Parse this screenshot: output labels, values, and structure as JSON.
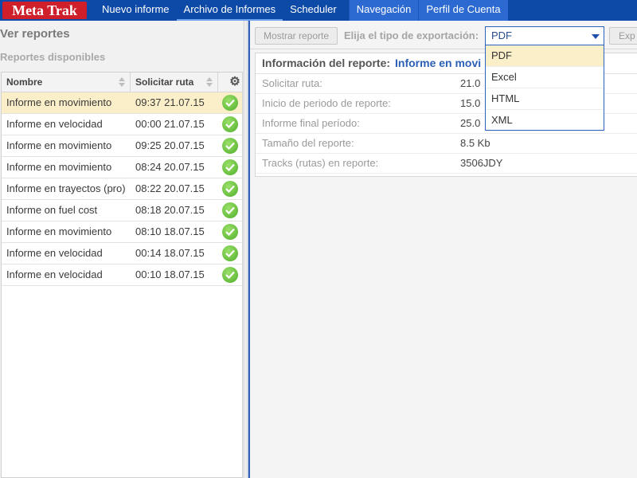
{
  "nav": {
    "logo": "Meta Trak",
    "items": [
      {
        "label": "Nuevo informe"
      },
      {
        "label": "Archivo de Informes"
      },
      {
        "label": "Scheduler"
      },
      {
        "label": "Navegación"
      },
      {
        "label": "Perfil de Cuenta"
      }
    ]
  },
  "left": {
    "title": "Ver reportes",
    "subtitle": "Reportes disponibles",
    "columns": {
      "name": "Nombre",
      "route": "Solicitar ruta",
      "settings_icon": "gear-icon"
    },
    "rows": [
      {
        "name": "Informe en movimiento",
        "time": "09:37 21.07.15",
        "selected": true
      },
      {
        "name": "Informe en velocidad",
        "time": "00:00 21.07.15"
      },
      {
        "name": "Informe en movimiento",
        "time": "09:25 20.07.15"
      },
      {
        "name": "Informe en movimiento",
        "time": "08:24 20.07.15"
      },
      {
        "name": "Informe en trayectos (pro)",
        "time": "08:22 20.07.15"
      },
      {
        "name": "Informe on fuel cost",
        "time": "08:18 20.07.15"
      },
      {
        "name": "Informe en movimiento",
        "time": "08:10 18.07.15"
      },
      {
        "name": "Informe en velocidad",
        "time": "00:14 18.07.15"
      },
      {
        "name": "Informe en velocidad",
        "time": "00:10 18.07.15"
      }
    ],
    "status_icon": "check-icon"
  },
  "toolbar": {
    "show_button": "Mostrar reporte",
    "export_label": "Elija el tipo de exportación:",
    "export_selected": "PDF",
    "export_button": "Exp"
  },
  "info": {
    "label": "Información del reporte:",
    "value": "Informe en movi",
    "rows": [
      {
        "k": "Solicitar ruta:",
        "v": "21.0"
      },
      {
        "k": "Inicio de periodo de reporte:",
        "v": "15.0"
      },
      {
        "k": "Informe final período:",
        "v": "25.0"
      },
      {
        "k": "Tamaño del reporte:",
        "v": "8.5 Kb"
      },
      {
        "k": "Tracks (rutas) en reporte:",
        "v": "3506JDY"
      }
    ]
  },
  "dropdown": {
    "options": [
      "PDF",
      "Excel",
      "HTML",
      "XML"
    ]
  },
  "colors": {
    "nav_bg": "#0d4aa8",
    "logo_bg": "#cf1f2b",
    "selected_row": "#fbefc9",
    "accent": "#2a5fb6"
  }
}
